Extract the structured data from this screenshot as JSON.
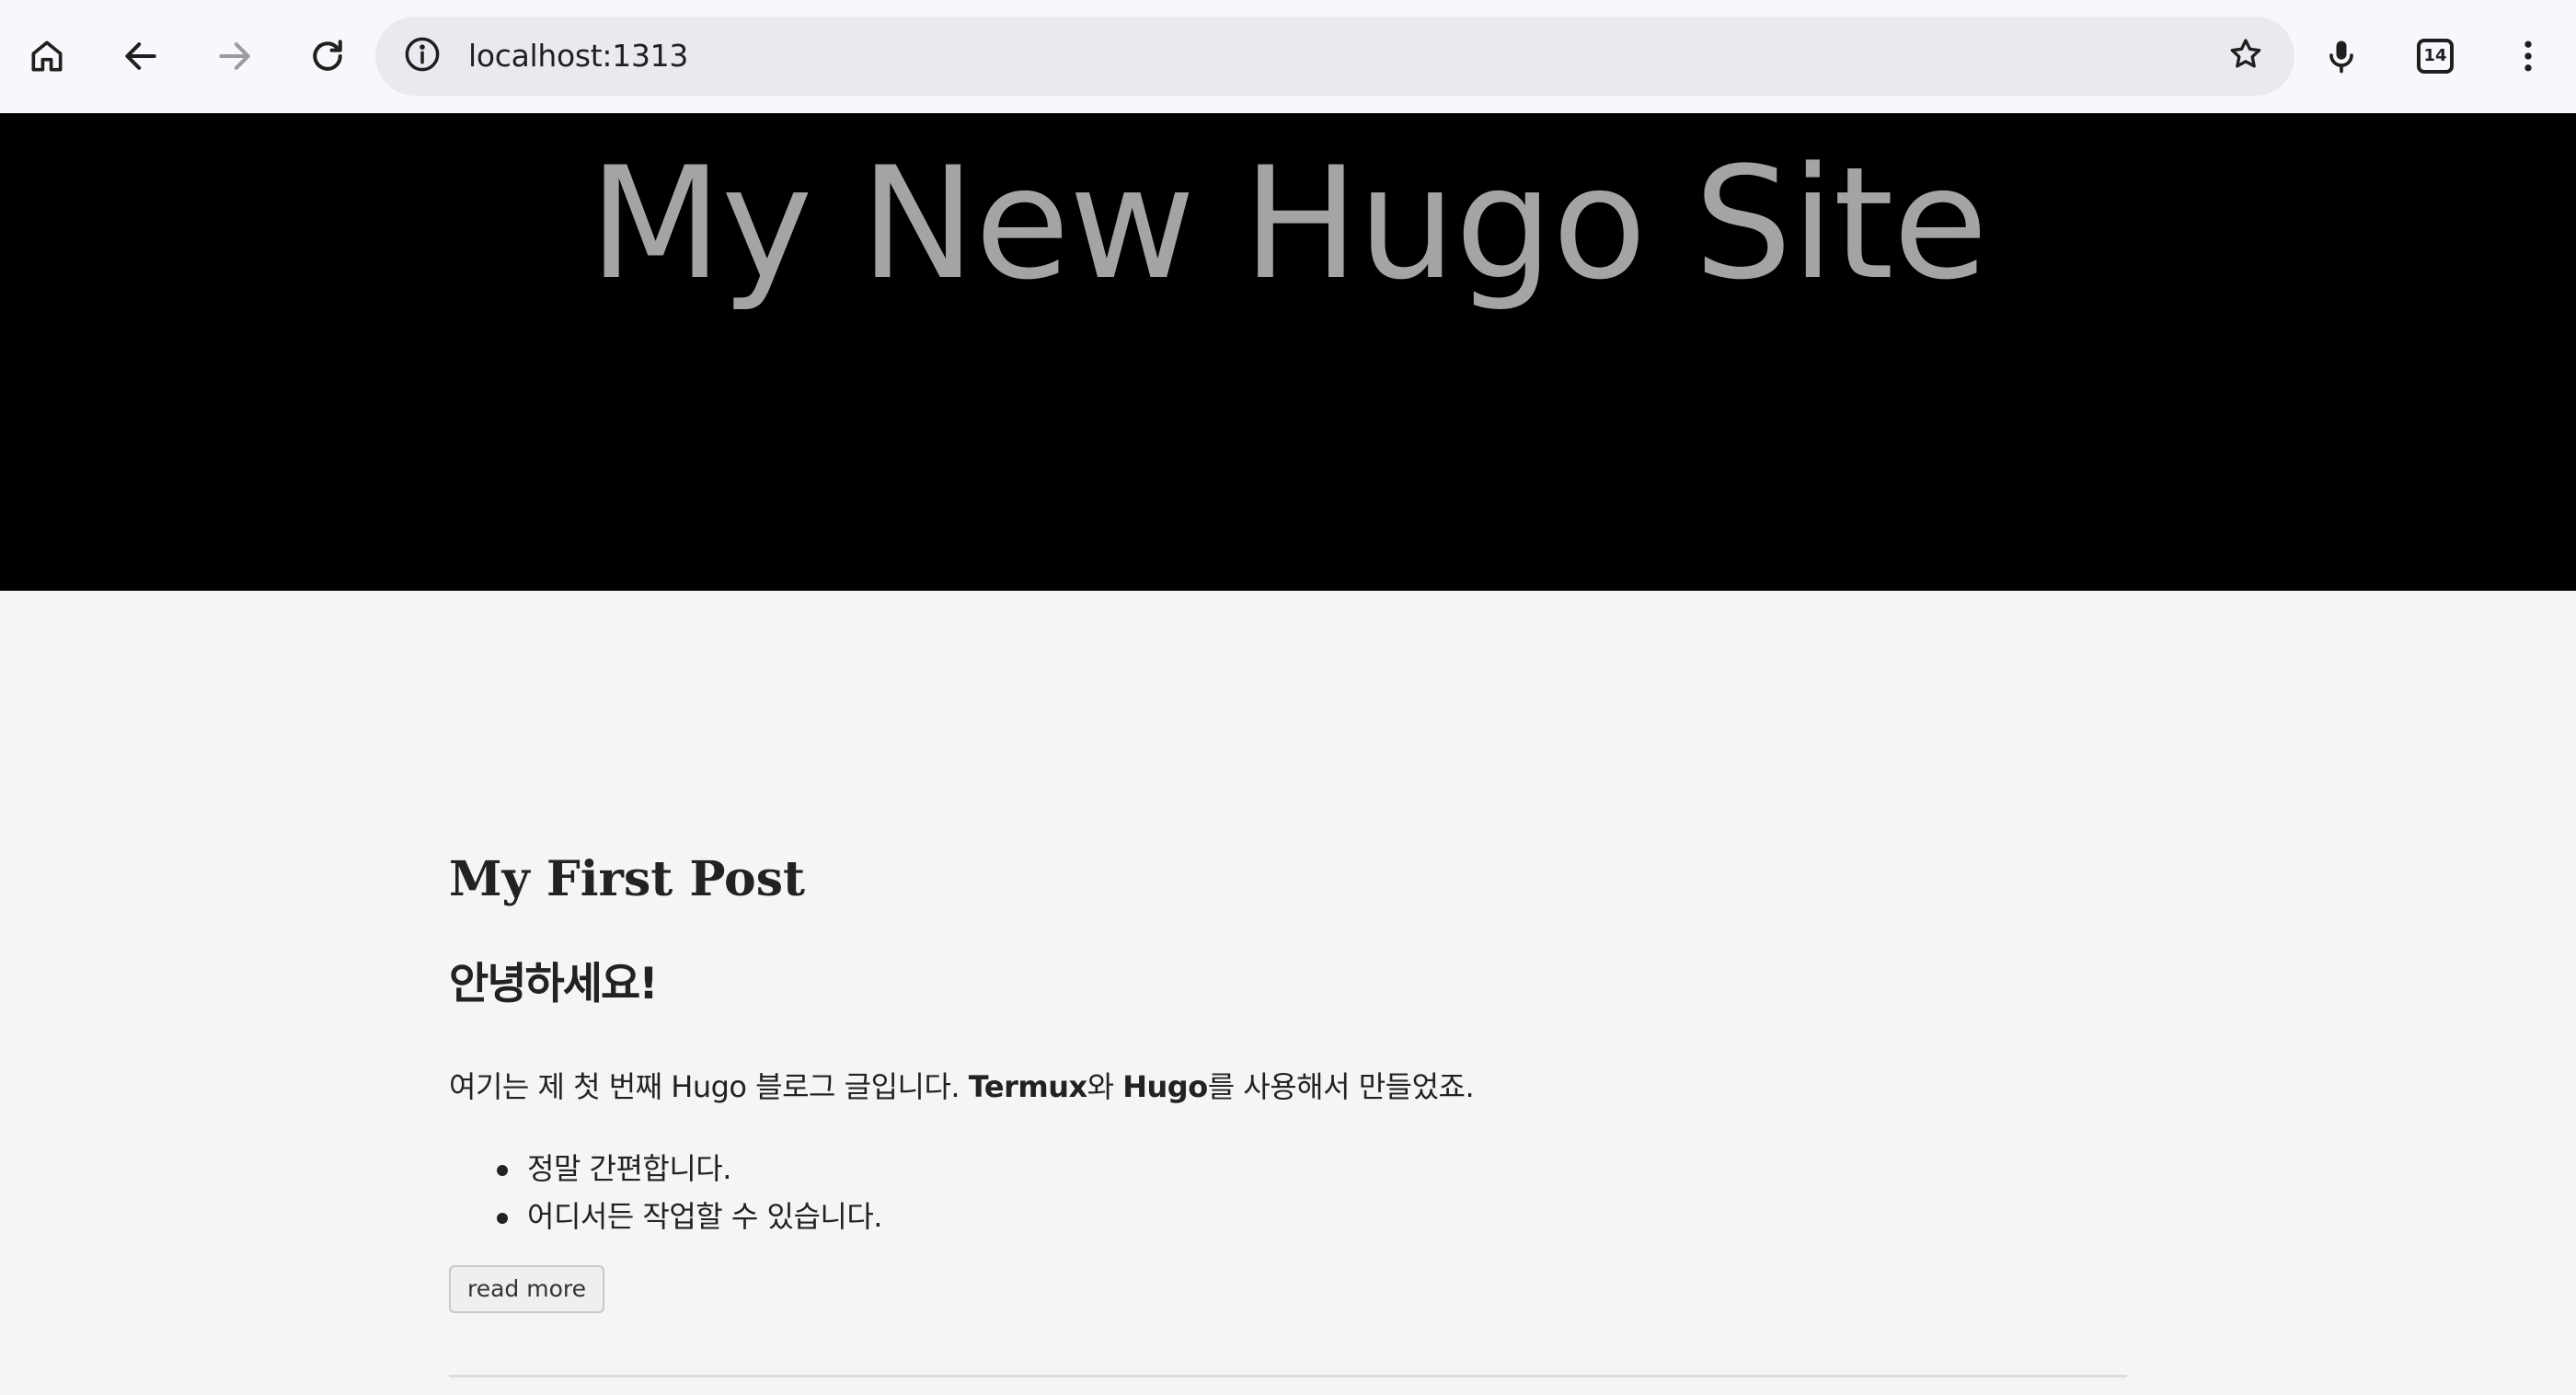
{
  "browser": {
    "url": "localhost:1313",
    "tab_count": "14",
    "icons": {
      "home": "home-icon",
      "back": "arrow-left-icon",
      "forward": "arrow-right-icon",
      "reload": "reload-icon",
      "site_info": "info-icon",
      "bookmark": "star-icon",
      "mic": "microphone-icon",
      "tabs": "tab-switcher-icon",
      "menu": "more-vertical-icon"
    },
    "colors": {
      "toolbar_bg": "#f7f7fc",
      "omnibox_bg": "#e9e9ef"
    }
  },
  "site": {
    "title": "My New Hugo Site",
    "colors": {
      "header_bg": "#000000",
      "title_color": "#a4a4a4",
      "page_bg": "#f5f5f5",
      "text": "#222222"
    }
  },
  "post": {
    "title": "My First Post",
    "heading": "안녕하세요!",
    "paragraph": {
      "part1": "여기는 제 첫 번째 Hugo 블로그 글입니다. ",
      "bold1": "Termux",
      "part2": "와 ",
      "bold2": "Hugo",
      "part3": "를 사용해서 만들었죠."
    },
    "list": [
      "정말 간편합니다.",
      "어디서든 작업할 수 있습니다."
    ],
    "read_more_label": "read more"
  }
}
